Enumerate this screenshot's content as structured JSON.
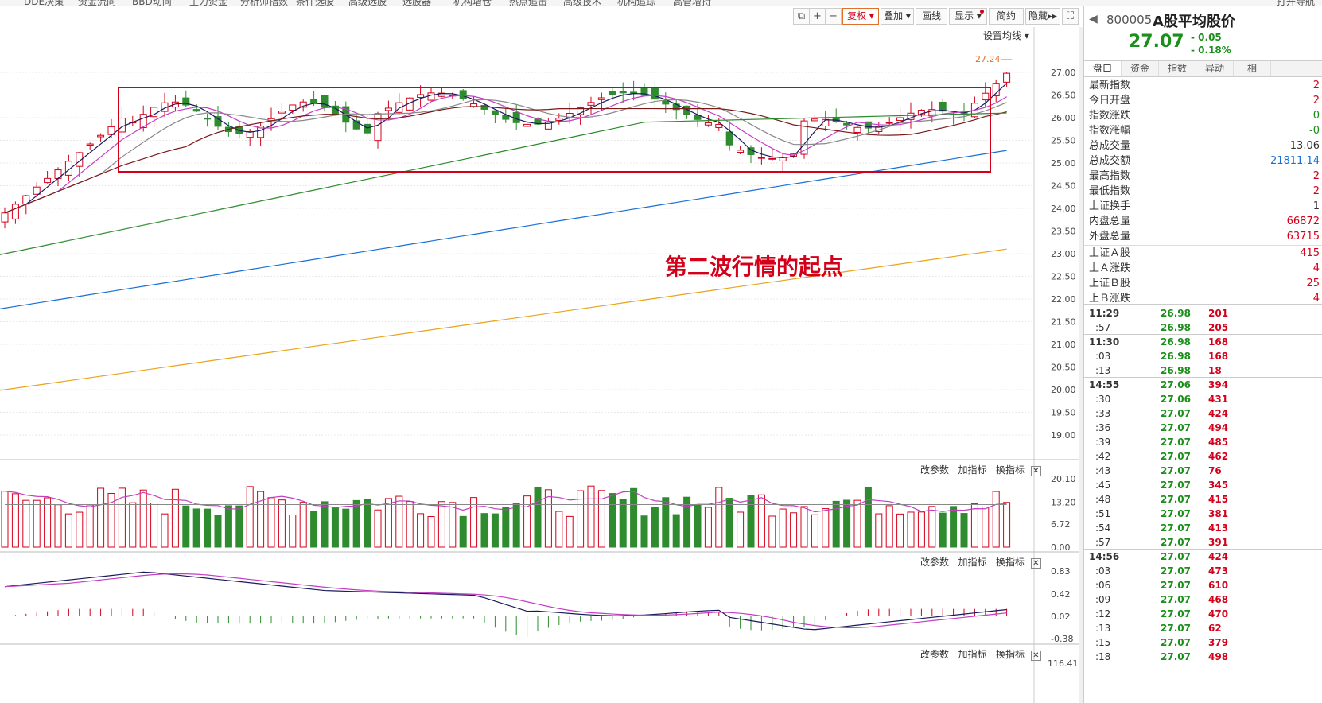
{
  "topnav": {
    "items": [
      "DDE决策",
      "资金流向",
      "BBD动向",
      "主力资金",
      "分析师指数",
      "条件选股",
      "高级选股",
      "选股器",
      "机构增仓",
      "热点追击",
      "高级技术",
      "机构追踪",
      "高管增持",
      "打开导航"
    ]
  },
  "toolbar": {
    "fuquan": "复权",
    "diejia": "叠加",
    "huaxian": "画线",
    "xianshi": "显示",
    "jianyue": "简约",
    "yincang": "隐藏",
    "shezhi_junxian": "设置均线"
  },
  "chart": {
    "price_label": "27.24",
    "annotation": "第二波行情的起点",
    "y_labels": [
      "27.00",
      "26.50",
      "26.00",
      "25.50",
      "25.00",
      "24.50",
      "24.00",
      "23.50",
      "23.00",
      "22.50",
      "22.00",
      "21.50",
      "21.00",
      "20.50",
      "20.00",
      "19.50",
      "19.00"
    ],
    "vol_labels": [
      "20.10",
      "13.20",
      "6.72",
      "0.00"
    ],
    "macd_labels": [
      "0.83",
      "0.42",
      "0.02",
      "-0.38"
    ],
    "bottom_label": "116.41",
    "indicator_controls": {
      "gaicanshu": "改参数",
      "jiazhibiao": "加指标",
      "huanzhibiao": "换指标"
    }
  },
  "colors": {
    "up": "#d4001a",
    "down": "#2e8b2e",
    "accent": "#e0702b"
  },
  "sidebar": {
    "code": "800005",
    "name": "A股平均股价",
    "price": "27.07",
    "change": "0.05",
    "change_pct": "0.18%",
    "tabs": [
      "盘口",
      "资金",
      "指数",
      "异动",
      "相"
    ],
    "stats": [
      {
        "label": "最新指数",
        "value": "2"
      },
      {
        "label": "今日开盘",
        "value": "2"
      },
      {
        "label": "指数涨跌",
        "value": "0"
      },
      {
        "label": "指数涨幅",
        "value": "-0"
      },
      {
        "label": "总成交量",
        "value": "13.06"
      },
      {
        "label": "总成交额",
        "value": "21811.14"
      },
      {
        "label": "最高指数",
        "value": "2"
      },
      {
        "label": "最低指数",
        "value": "2"
      },
      {
        "label": "上证换手",
        "value": "1"
      },
      {
        "label": "内盘总量",
        "value": "66872"
      },
      {
        "label": "外盘总量",
        "value": "63715"
      },
      {
        "label": "上证Ａ股",
        "value": "415"
      },
      {
        "label": "上Ａ涨跌",
        "value": "4"
      },
      {
        "label": "上证Ｂ股",
        "value": "25"
      },
      {
        "label": "上Ｂ涨跌",
        "value": "4"
      }
    ],
    "ticks": [
      {
        "time": "11:29",
        "price": "26.98",
        "vol": "201",
        "major": true
      },
      {
        "time": ":57",
        "price": "26.98",
        "vol": "205",
        "major": false
      },
      {
        "time": "11:30",
        "price": "26.98",
        "vol": "168",
        "major": true
      },
      {
        "time": ":03",
        "price": "26.98",
        "vol": "168",
        "major": false
      },
      {
        "time": ":13",
        "price": "26.98",
        "vol": "18",
        "major": false
      },
      {
        "time": "14:55",
        "price": "27.06",
        "vol": "394",
        "major": true
      },
      {
        "time": ":30",
        "price": "27.06",
        "vol": "431",
        "major": false
      },
      {
        "time": ":33",
        "price": "27.07",
        "vol": "424",
        "major": false
      },
      {
        "time": ":36",
        "price": "27.07",
        "vol": "494",
        "major": false
      },
      {
        "time": ":39",
        "price": "27.07",
        "vol": "485",
        "major": false
      },
      {
        "time": ":42",
        "price": "27.07",
        "vol": "462",
        "major": false
      },
      {
        "time": ":43",
        "price": "27.07",
        "vol": "76",
        "major": false
      },
      {
        "time": ":45",
        "price": "27.07",
        "vol": "345",
        "major": false
      },
      {
        "time": ":48",
        "price": "27.07",
        "vol": "415",
        "major": false
      },
      {
        "time": ":51",
        "price": "27.07",
        "vol": "381",
        "major": false
      },
      {
        "time": ":54",
        "price": "27.07",
        "vol": "413",
        "major": false
      },
      {
        "time": ":57",
        "price": "27.07",
        "vol": "391",
        "major": false
      },
      {
        "time": "14:56",
        "price": "27.07",
        "vol": "424",
        "major": true
      },
      {
        "time": ":03",
        "price": "27.07",
        "vol": "473",
        "major": false
      },
      {
        "time": ":06",
        "price": "27.07",
        "vol": "610",
        "major": false
      },
      {
        "time": ":09",
        "price": "27.07",
        "vol": "468",
        "major": false
      },
      {
        "time": ":12",
        "price": "27.07",
        "vol": "470",
        "major": false
      },
      {
        "time": ":13",
        "price": "27.07",
        "vol": "62",
        "major": false
      },
      {
        "time": ":15",
        "price": "27.07",
        "vol": "379",
        "major": false
      },
      {
        "time": ":18",
        "price": "27.07",
        "vol": "498",
        "major": false
      }
    ]
  }
}
